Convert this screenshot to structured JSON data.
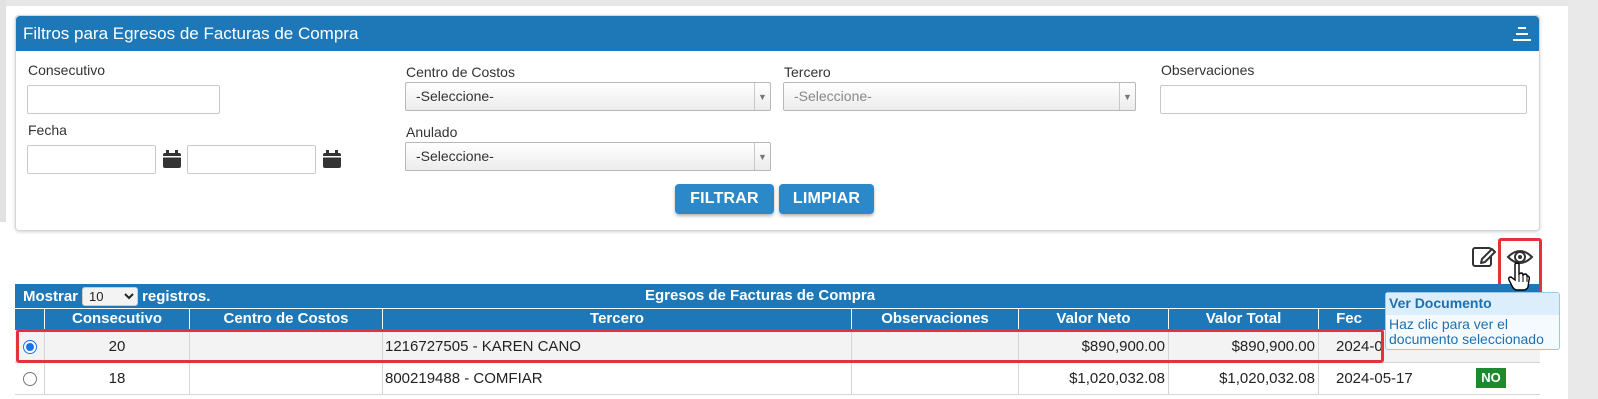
{
  "filters": {
    "title": "Filtros para Egresos de Facturas de Compra",
    "consecutivo_label": "Consecutivo",
    "fecha_label": "Fecha",
    "centro_label": "Centro de Costos",
    "centro_value": "-Seleccione-",
    "anulado_label": "Anulado",
    "anulado_value": "-Seleccione-",
    "tercero_label": "Tercero",
    "tercero_placeholder": "-Seleccione-",
    "observaciones_label": "Observaciones",
    "filtrar_label": "FILTRAR",
    "limpiar_label": "LIMPIAR"
  },
  "toolbar": {
    "edit_icon": "edit-icon",
    "view_icon": "eye-icon"
  },
  "tooltip": {
    "title": "Ver Documento",
    "body_line1": "Haz clic para ver el",
    "body_line2": "documento seleccionado"
  },
  "grid": {
    "show_prefix": "Mostrar",
    "page_size": "10",
    "show_suffix": "registros.",
    "caption": "Egresos de Facturas de Compra",
    "columns": [
      "Consecutivo",
      "Centro de Costos",
      "Tercero",
      "Observaciones",
      "Valor Neto",
      "Valor Total",
      "Fec"
    ],
    "rows": [
      {
        "selected": true,
        "consecutivo": "20",
        "centro": "",
        "tercero": "1216727505 - KAREN CANO",
        "observaciones": "",
        "valor_neto": "$890,900.00",
        "valor_total": "$890,900.00",
        "fecha": "2024-0",
        "anulado": ""
      },
      {
        "selected": false,
        "consecutivo": "18",
        "centro": "",
        "tercero": "800219488 - COMFIAR",
        "observaciones": "",
        "valor_neto": "$1,020,032.08",
        "valor_total": "$1,020,032.08",
        "fecha": "2024-05-17",
        "anulado": "NO"
      }
    ]
  },
  "colors": {
    "header_blue": "#1e78b8",
    "button_blue": "#2b89c9",
    "highlight_red": "#e53238",
    "badge_green": "#1e8a2e"
  }
}
